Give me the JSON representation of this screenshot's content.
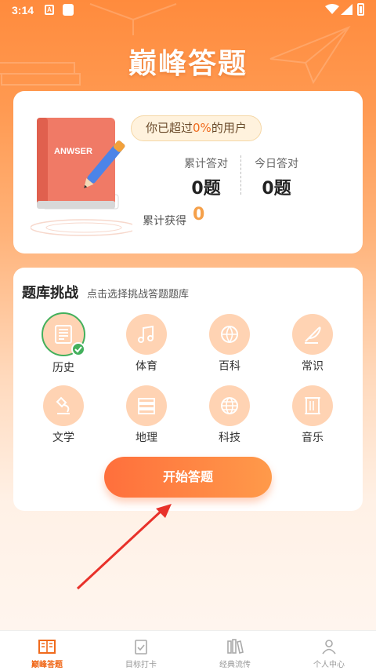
{
  "status_bar": {
    "time": "3:14",
    "notif_letter": "A"
  },
  "app_title": "巅峰答题",
  "summary": {
    "exceed_prefix": "你已超过",
    "exceed_percent": "0%",
    "exceed_suffix": "的用户",
    "total_label": "累计答对",
    "total_value": "0题",
    "today_label": "今日答对",
    "today_value": "0题",
    "earned_label": "累计获得",
    "earned_value": "0",
    "book_text": "ANWSER"
  },
  "challenge": {
    "title": "题库挑战",
    "subtitle": "点击选择挑战答题题库",
    "categories": [
      {
        "label": "历史",
        "icon": "history-icon",
        "selected": true
      },
      {
        "label": "体育",
        "icon": "music-note-icon",
        "selected": false
      },
      {
        "label": "百科",
        "icon": "ball-icon",
        "selected": false
      },
      {
        "label": "常识",
        "icon": "feather-icon",
        "selected": false
      },
      {
        "label": "文学",
        "icon": "microscope-icon",
        "selected": false
      },
      {
        "label": "地理",
        "icon": "books-icon",
        "selected": false
      },
      {
        "label": "科技",
        "icon": "globe-icon",
        "selected": false
      },
      {
        "label": "音乐",
        "icon": "scroll-icon",
        "selected": false
      }
    ],
    "start_label": "开始答题"
  },
  "tabs": [
    {
      "label": "巅峰答题",
      "icon": "book-open-icon",
      "active": true
    },
    {
      "label": "目标打卡",
      "icon": "clipboard-check-icon",
      "active": false
    },
    {
      "label": "经典流传",
      "icon": "bookshelf-icon",
      "active": false
    },
    {
      "label": "个人中心",
      "icon": "user-icon",
      "active": false
    }
  ],
  "colors": {
    "accent": "#FF8B3D",
    "selected_ring": "#43B05C",
    "badge_bg": "#FFF2DD"
  }
}
